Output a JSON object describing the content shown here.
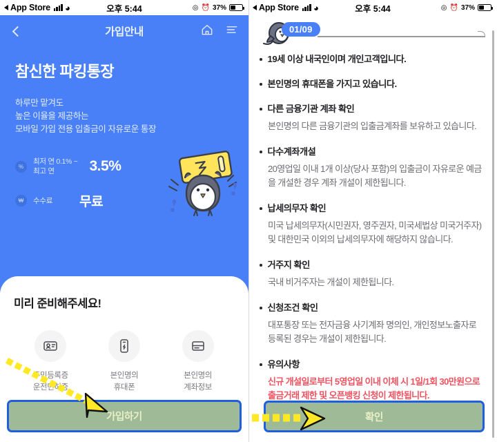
{
  "status_bar": {
    "app_label": "App Store",
    "time": "오후 5:44",
    "battery_pct": "37%",
    "signal_icon": "cellular-signal-icon",
    "wifi_icon": "wifi-icon",
    "location_icon": "location-icon",
    "alarm_icon": "alarm-icon",
    "battery_icon": "battery-icon"
  },
  "left_screen": {
    "header": {
      "back_icon": "back-chevron-icon",
      "title": "가입안내",
      "home_icon": "home-icon",
      "menu_icon": "hamburger-menu-icon"
    },
    "hero": {
      "title": "참신한 파킹통장",
      "subtitle_lines": [
        "하루만 맡겨도",
        "높은 이율을 제공하는",
        "모바일 가입 전용 입출금이 자유로운 통장"
      ],
      "mascot_icon": "penguin-mascot-icon"
    },
    "rates": [
      {
        "badge": "%",
        "badge_icon": "percent-icon",
        "label_lines": [
          "최저 연 0.1% ~",
          "최고 연"
        ],
        "value": "3.5%"
      },
      {
        "badge": "₩",
        "badge_icon": "won-icon",
        "label_lines": [
          "수수료"
        ],
        "value": "무료"
      }
    ],
    "prepare": {
      "title": "미리 준비해주세요!",
      "items": [
        {
          "icon": "id-card-icon",
          "label_lines": [
            "주민등록증",
            "운전면허증"
          ]
        },
        {
          "icon": "mobile-phone-icon",
          "label_lines": [
            "본인명의",
            "휴대폰"
          ]
        },
        {
          "icon": "bankbook-icon",
          "label_lines": [
            "본인명의",
            "계좌정보"
          ]
        }
      ]
    },
    "cta_button": "가입하기"
  },
  "right_screen": {
    "progress": {
      "step_badge": "01/09",
      "mascot_icon": "penguin-progress-icon"
    },
    "terms": [
      {
        "title": "19세 이상 내국인이며 개인고객입니다.",
        "body": "",
        "warn": false
      },
      {
        "title": "본인명의 휴대폰을 가지고 있습니다.",
        "body": "",
        "warn": false
      },
      {
        "title": "다른 금융기관 계좌 확인",
        "body": "본인명의 다른 금융기관의 입출금계좌를 보유하고 있습니다.",
        "warn": false
      },
      {
        "title": "다수계좌개설",
        "body": "20영업일 이내 1개 이상(당사 포함)의 입출금이 자유로운 예금을 개설한 경우 계좌 개설이 제한됩니다.",
        "warn": false
      },
      {
        "title": "납세의무자 확인",
        "body": "미국 납세의무자(시민권자, 영주권자, 미국세법상 미국거주자) 및 대한민국 이외의 납세의무자에 해당하지 않습니다.",
        "warn": false
      },
      {
        "title": "거주지 확인",
        "body": "국내 비거주자는 개설이 제한됩니다.",
        "warn": false
      },
      {
        "title": "신청조건 확인",
        "body": "대포통장 또는 전자금융 사기계좌 명의인, 개인정보노출자로 등록된 경우는 개설이 제한됩니다.",
        "warn": false
      },
      {
        "title": "유의사항",
        "body": "신규 개설일로부터 5영업일 이내 이체 시 1일/1회 30만원으로 출금거래 제한 및 오픈뱅킹 신청이 제한됩니다.",
        "warn": true
      }
    ],
    "cta_button": "확인"
  },
  "annotations": {
    "arrow_icon": "dashed-arrow-icon",
    "highlight_border_color": "#1f5ede",
    "highlight_fill_color": "rgba(120,160,110,0.72)",
    "arrow_color": "#ffe926"
  },
  "theme": {
    "brand_blue": "#4a80f7",
    "warn_red": "#f0525f",
    "card_white": "#ffffff"
  }
}
